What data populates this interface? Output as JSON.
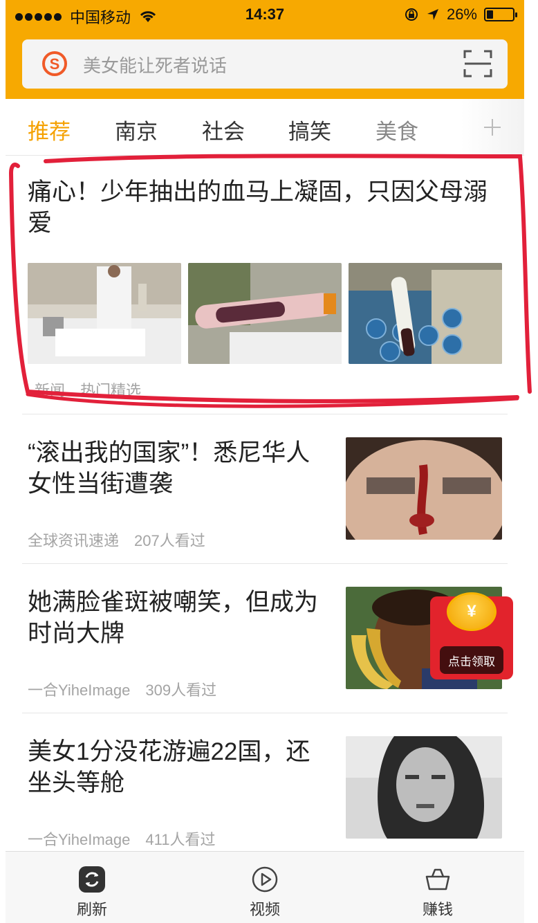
{
  "status_bar": {
    "carrier": "中国移动",
    "time": "14:37",
    "battery": "26%",
    "battery_level": 0.26
  },
  "search": {
    "placeholder": "美女能让死者说话",
    "logo_icon": "sogou-logo-icon",
    "scan_icon": "scan-icon"
  },
  "tabs": [
    "推荐",
    "南京",
    "社会",
    "搞笑",
    "美食"
  ],
  "add_channel_icon": "plus-icon",
  "feed": {
    "featured": {
      "title": "痛心！少年抽出的血马上凝固，只因父母溺爱",
      "meta": [
        "新闻",
        "热门精选"
      ]
    },
    "items": [
      {
        "title": "“滚出我的国家”！悉尼华人女性当街遭袭",
        "source": "全球资讯速递",
        "views": "207人看过"
      },
      {
        "title": "她满脸雀斑被嘲笑，但成为时尚大牌",
        "source": "一合YiheImage",
        "views": "309人看过"
      },
      {
        "title": "美女1分没花游遍22国，还坐头等舱",
        "source": "一合YiheImage",
        "views": "411人看过"
      }
    ]
  },
  "red_envelope": {
    "coin_symbol": "¥",
    "button": "点击领取"
  },
  "bottom_nav": [
    {
      "label": "刷新",
      "icon": "refresh-icon"
    },
    {
      "label": "视频",
      "icon": "play-icon"
    },
    {
      "label": "赚钱",
      "icon": "basket-icon"
    }
  ],
  "colors": {
    "brand": "#f7a901",
    "tab_active": "#f5a101",
    "annotation": "#e2203a",
    "envelope": "#e2232c"
  }
}
